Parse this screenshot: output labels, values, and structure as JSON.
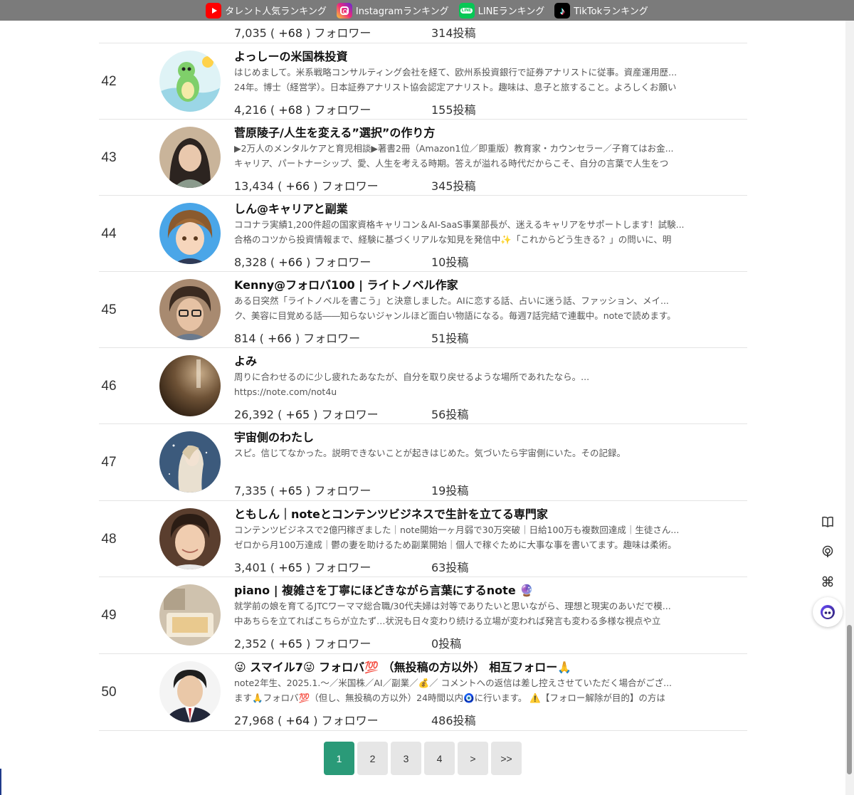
{
  "topbar": {
    "links": [
      {
        "label": "タレント人気ランキング",
        "icon": "youtube-icon"
      },
      {
        "label": "Instagramランキング",
        "icon": "instagram-icon"
      },
      {
        "label": "LINEランキング",
        "icon": "line-icon"
      },
      {
        "label": "TikTokランキング",
        "icon": "tiktok-icon"
      }
    ]
  },
  "partial_row": {
    "followers": "7,035",
    "gain": "+68",
    "followers_suffix": "フォロワー",
    "posts": "314投稿"
  },
  "rows": [
    {
      "rank": "42",
      "name": "よっしーの米国株投資",
      "desc": [
        "はじめまして。米系戦略コンサルティング会社を経て、欧州系投資銀行で証券アナリストに従事。資産運用歴...",
        "24年。博士（経営学）。日本証券アナリスト協会認定アナリスト。趣味は、息子と旅すること。よろしくお願い"
      ],
      "followers": "4,216",
      "gain": "+68",
      "followers_suffix": "フォロワー",
      "posts": "155投稿"
    },
    {
      "rank": "43",
      "name": "菅原陵子/人生を変える”選択”の作り方",
      "desc": [
        "▶2万人のメンタルケアと育児相談▶著書2冊（Amazon1位／即重版）教育家・カウンセラー／子育てはお金...",
        "キャリア、パートナーシップ、愛、人生を考える時期。答えが溢れる時代だからこそ、自分の言葉で人生をつ"
      ],
      "followers": "13,434",
      "gain": "+66",
      "followers_suffix": "フォロワー",
      "posts": "345投稿"
    },
    {
      "rank": "44",
      "name": "しん@キャリアと副業",
      "desc": [
        "ココナラ実績1,200件超の国家資格キャリコン＆AI-SaaS事業部長が、迷えるキャリアをサポートします！試験...",
        "合格のコツから投資情報まで、経験に基づくリアルな知見を発信中✨「これからどう生きる？」の問いに、明"
      ],
      "followers": "8,328",
      "gain": "+66",
      "followers_suffix": "フォロワー",
      "posts": "10投稿"
    },
    {
      "rank": "45",
      "name": "Kenny@フォロバ100 | ライトノベル作家",
      "desc": [
        "ある日突然「ライトノベルを書こう」と決意しました。AIに恋する話、占いに迷う話、ファッション、メイ...",
        "ク、美容に目覚める話――知らないジャンルほど面白い物語になる。毎週7話完結で連載中。noteで読めます。"
      ],
      "followers": "814",
      "gain": "+66",
      "followers_suffix": "フォロワー",
      "posts": "51投稿"
    },
    {
      "rank": "46",
      "name": "よみ",
      "desc": [
        "周りに合わせるのに少し疲れたあなたが、自分を取り戻せるような場所であれたなら。...",
        "https://note.com/not4u"
      ],
      "followers": "26,392",
      "gain": "+65",
      "followers_suffix": "フォロワー",
      "posts": "56投稿"
    },
    {
      "rank": "47",
      "name": "宇宙側のわたし",
      "desc": [
        "スピ。信じてなかった。説明できないことが起きはじめた。気づいたら宇宙側にいた。その記録。",
        ""
      ],
      "followers": "7,335",
      "gain": "+65",
      "followers_suffix": "フォロワー",
      "posts": "19投稿"
    },
    {
      "rank": "48",
      "name": "ともしん｜noteとコンテンツビジネスで生計を立てる専門家",
      "desc": [
        "コンテンツビジネスで2億円稼ぎました｜note開始一ヶ月弱で30万突破｜日給100万も複数回達成｜生徒さん...",
        "ゼロから月100万達成｜鬱の妻を助けるため副業開始｜個人で稼ぐために大事な事を書いてます。趣味は柔術。"
      ],
      "followers": "3,401",
      "gain": "+65",
      "followers_suffix": "フォロワー",
      "posts": "63投稿"
    },
    {
      "rank": "49",
      "name": "piano |  複雑さを丁寧にほどきながら言葉にするnote 🔮",
      "desc": [
        "就学前の娘を育てるJTCワーママ総合職/30代夫婦は対等でありたいと思いながら、理想と現実のあいだで模...",
        "中あちらを立てればこちらが立たず…状況も日々変わり続ける立場が変われば発言も変わる多様な視点や立"
      ],
      "followers": "2,352",
      "gain": "+65",
      "followers_suffix": "フォロワー",
      "posts": "0投稿"
    },
    {
      "rank": "50",
      "name": "😜 スマイル7😜  フォロバ💯  （無投稿の方以外）  相互フォロー🙏",
      "desc": [
        "note2年生、2025.1.〜／米国株／AI／副業／💰／    コメントへの返信は差し控えさせていただく場合がござ...",
        "ます🙏フォロバ💯（但し、無投稿の方以外）24時間以内🧿に行います。  ⚠️【フォロー解除が目的】の方は"
      ],
      "followers": "27,968",
      "gain": "+64",
      "followers_suffix": "フォロワー",
      "posts": "486投稿"
    }
  ],
  "pagination": [
    "1",
    "2",
    "3",
    "4",
    ">",
    ">>"
  ],
  "pagination_active": "1",
  "colors": {
    "active_page": "#2a9a78",
    "topbar": "#7b7b7b"
  }
}
